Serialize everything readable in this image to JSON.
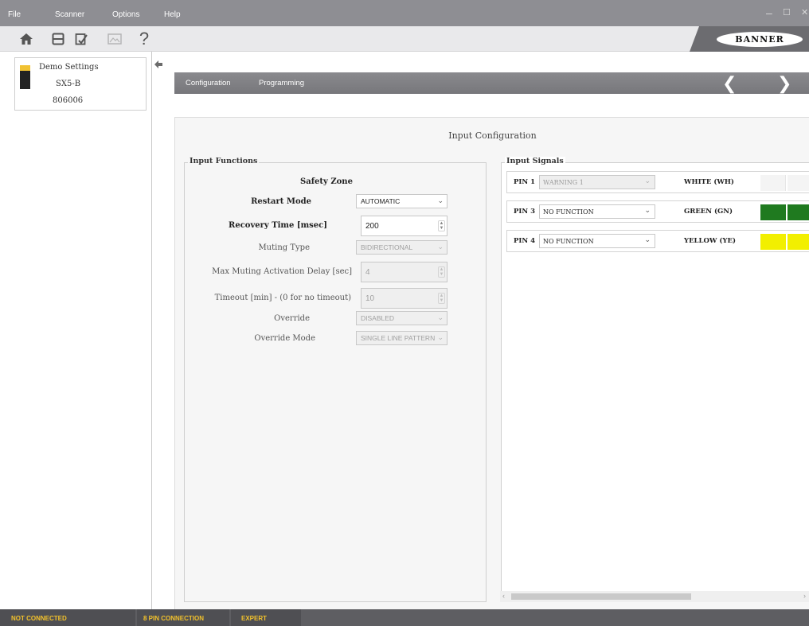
{
  "menu": {
    "items": [
      "File",
      "Scanner",
      "Options",
      "Help"
    ],
    "window_controls": [
      "–",
      "☐",
      "✕"
    ]
  },
  "toolbar": {
    "buttons": [
      {
        "name": "home-icon",
        "enabled": true
      },
      {
        "name": "save-icon",
        "enabled": true
      },
      {
        "name": "edit-document-icon",
        "enabled": true
      },
      {
        "name": "image-icon",
        "enabled": false
      },
      {
        "name": "help-icon",
        "enabled": true
      }
    ],
    "help_glyph": "?",
    "logo_text": "BANNER"
  },
  "device": {
    "name": "Demo Settings",
    "model": "SX5-B",
    "serial": "806006"
  },
  "tabs": {
    "configuration": "Configuration",
    "programming": "Programming",
    "prev_glyph": "❮",
    "next_glyph": "❯"
  },
  "page": {
    "title": "Input Configuration"
  },
  "input_functions": {
    "title": "Input Functions",
    "zone_title": "Safety Zone",
    "rows": [
      {
        "label": "Restart Mode",
        "value": "AUTOMATIC",
        "control": "dropdown",
        "enabled": true
      },
      {
        "label": "Recovery Time [msec]",
        "value": "200",
        "control": "spinner",
        "enabled": true
      },
      {
        "label": "Muting Type",
        "value": "BIDIRECTIONAL",
        "control": "dropdown",
        "enabled": false
      },
      {
        "label": "Max Muting Activation Delay [sec]",
        "value": "4",
        "control": "spinner",
        "enabled": false
      },
      {
        "label": "Timeout [min] - (0 for no timeout)",
        "value": "10",
        "control": "spinner",
        "enabled": false
      },
      {
        "label": "Override",
        "value": "DISABLED",
        "control": "dropdown",
        "enabled": false
      },
      {
        "label": "Override Mode",
        "value": "SINGLE LINE PATTERN",
        "control": "dropdown",
        "enabled": false
      }
    ]
  },
  "input_signals": {
    "title": "Input Signals",
    "pins": [
      {
        "pin": "PIN 1",
        "function": "WARNING 1",
        "enabled": false,
        "wire": "WHITE (WH)",
        "color": "#f4f4f4"
      },
      {
        "pin": "PIN 3",
        "function": "NO FUNCTION",
        "enabled": true,
        "wire": "GREEN (GN)",
        "color": "#1f7a1f"
      },
      {
        "pin": "PIN 4",
        "function": "NO FUNCTION",
        "enabled": true,
        "wire": "YELLOW (YE)",
        "color": "#f2ef00"
      }
    ]
  },
  "status": {
    "connection": "NOT CONNECTED",
    "pin_mode": "8 PIN CONNECTION",
    "user_level": "EXPERT"
  }
}
